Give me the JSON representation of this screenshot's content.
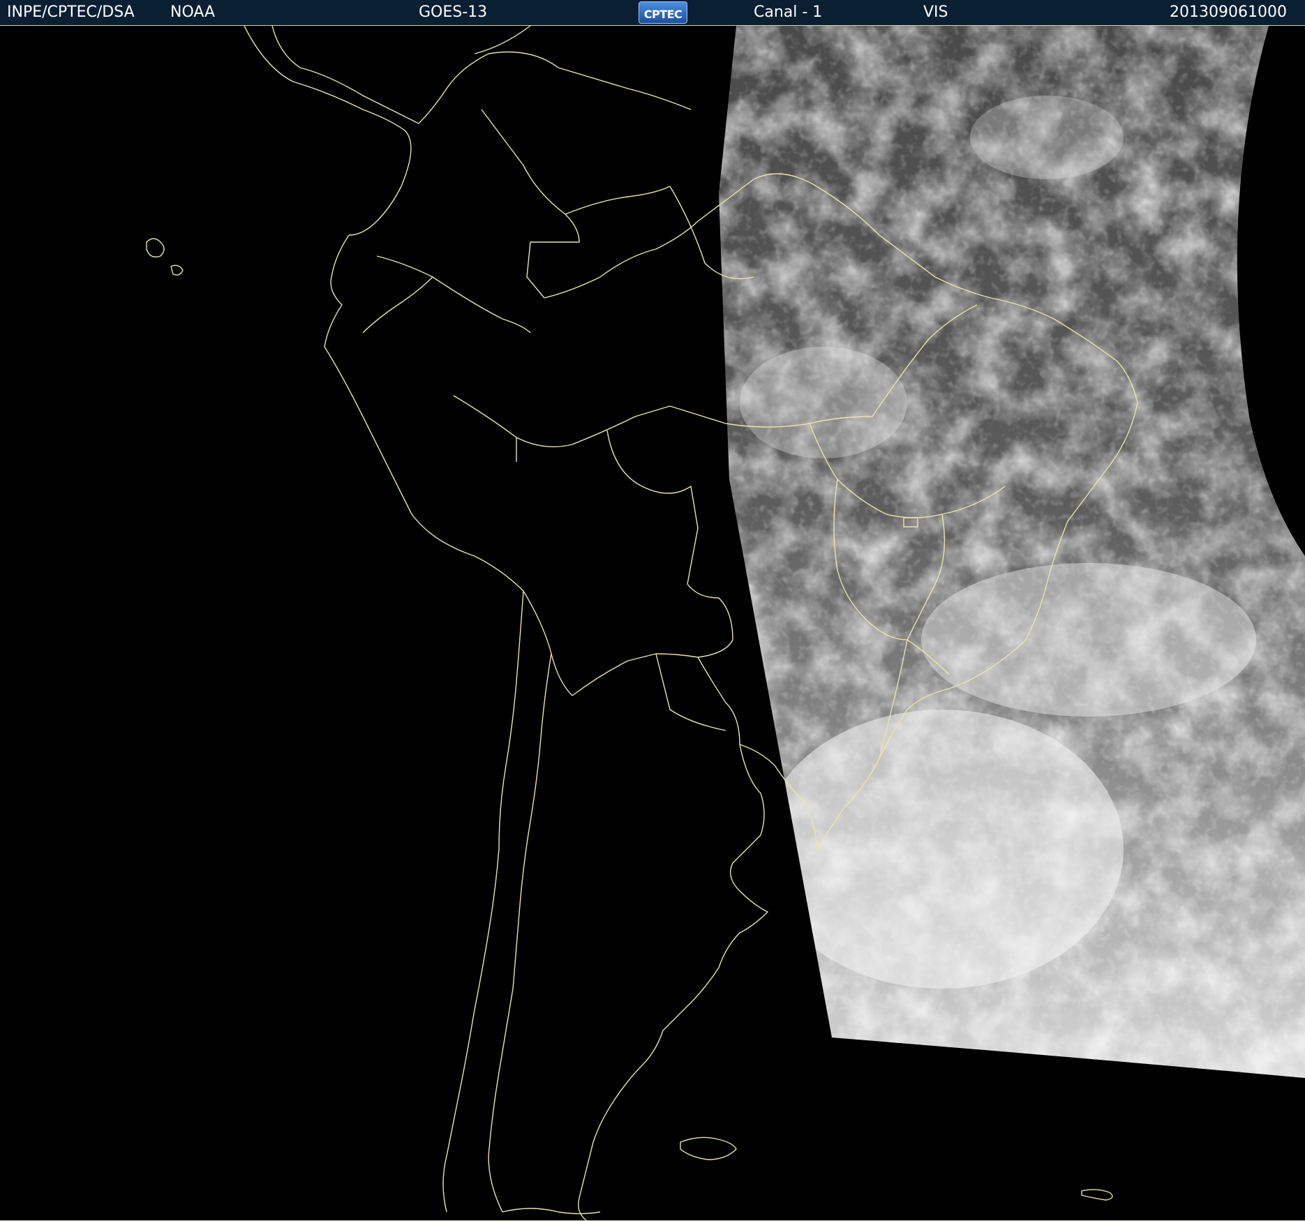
{
  "header": {
    "organization": "INPE/CPTEC/DSA",
    "agency": "NOAA",
    "satellite": "GOES-13",
    "logo_text": "CPTEC",
    "channel": "Canal - 1",
    "band": "VIS",
    "timestamp": "201309061000"
  },
  "colors": {
    "header_background": "#0b1f33",
    "border_lines": "#e8e6a8",
    "ocean_background": "#000000",
    "cloud_white": "#f2f2f2",
    "land_gray": "#5a5a5a"
  }
}
